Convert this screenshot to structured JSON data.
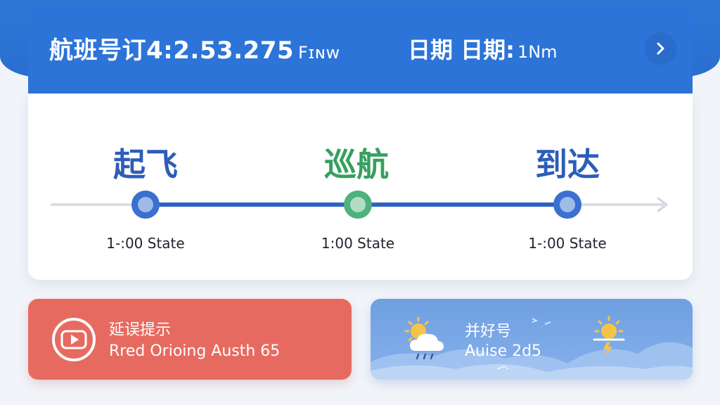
{
  "header": {
    "flight_text": "航班号订4:2.53.275",
    "flight_suffix": "Fɪɴw",
    "date_text": "日期 日期:",
    "date_suffix": "1Nm",
    "next_icon": "chevron-right-icon"
  },
  "timeline": {
    "stages": [
      {
        "label": "起飞",
        "time": "1-:00 State",
        "color": "#2d5db8",
        "node_color": "#3b6fd0"
      },
      {
        "label": "巡航",
        "time": "1:00 State",
        "color": "#36a05e",
        "node_color": "#4eb27a"
      },
      {
        "label": "到达",
        "time": "1-:00 State",
        "color": "#2d5db8",
        "node_color": "#3b6fd0"
      }
    ],
    "progress_color": "#2c62c4",
    "track_color": "#d9dde5"
  },
  "delay": {
    "title": "延误提示",
    "subtitle": "Rred Orioing Austh 65",
    "icon": "play-circle-icon",
    "color": "#e76a60"
  },
  "weather": {
    "title": "并好号",
    "subtitle": "Auise 2d5",
    "left_icon": "partly-cloudy-rain-icon",
    "right_icon": "sun-storm-icon"
  }
}
